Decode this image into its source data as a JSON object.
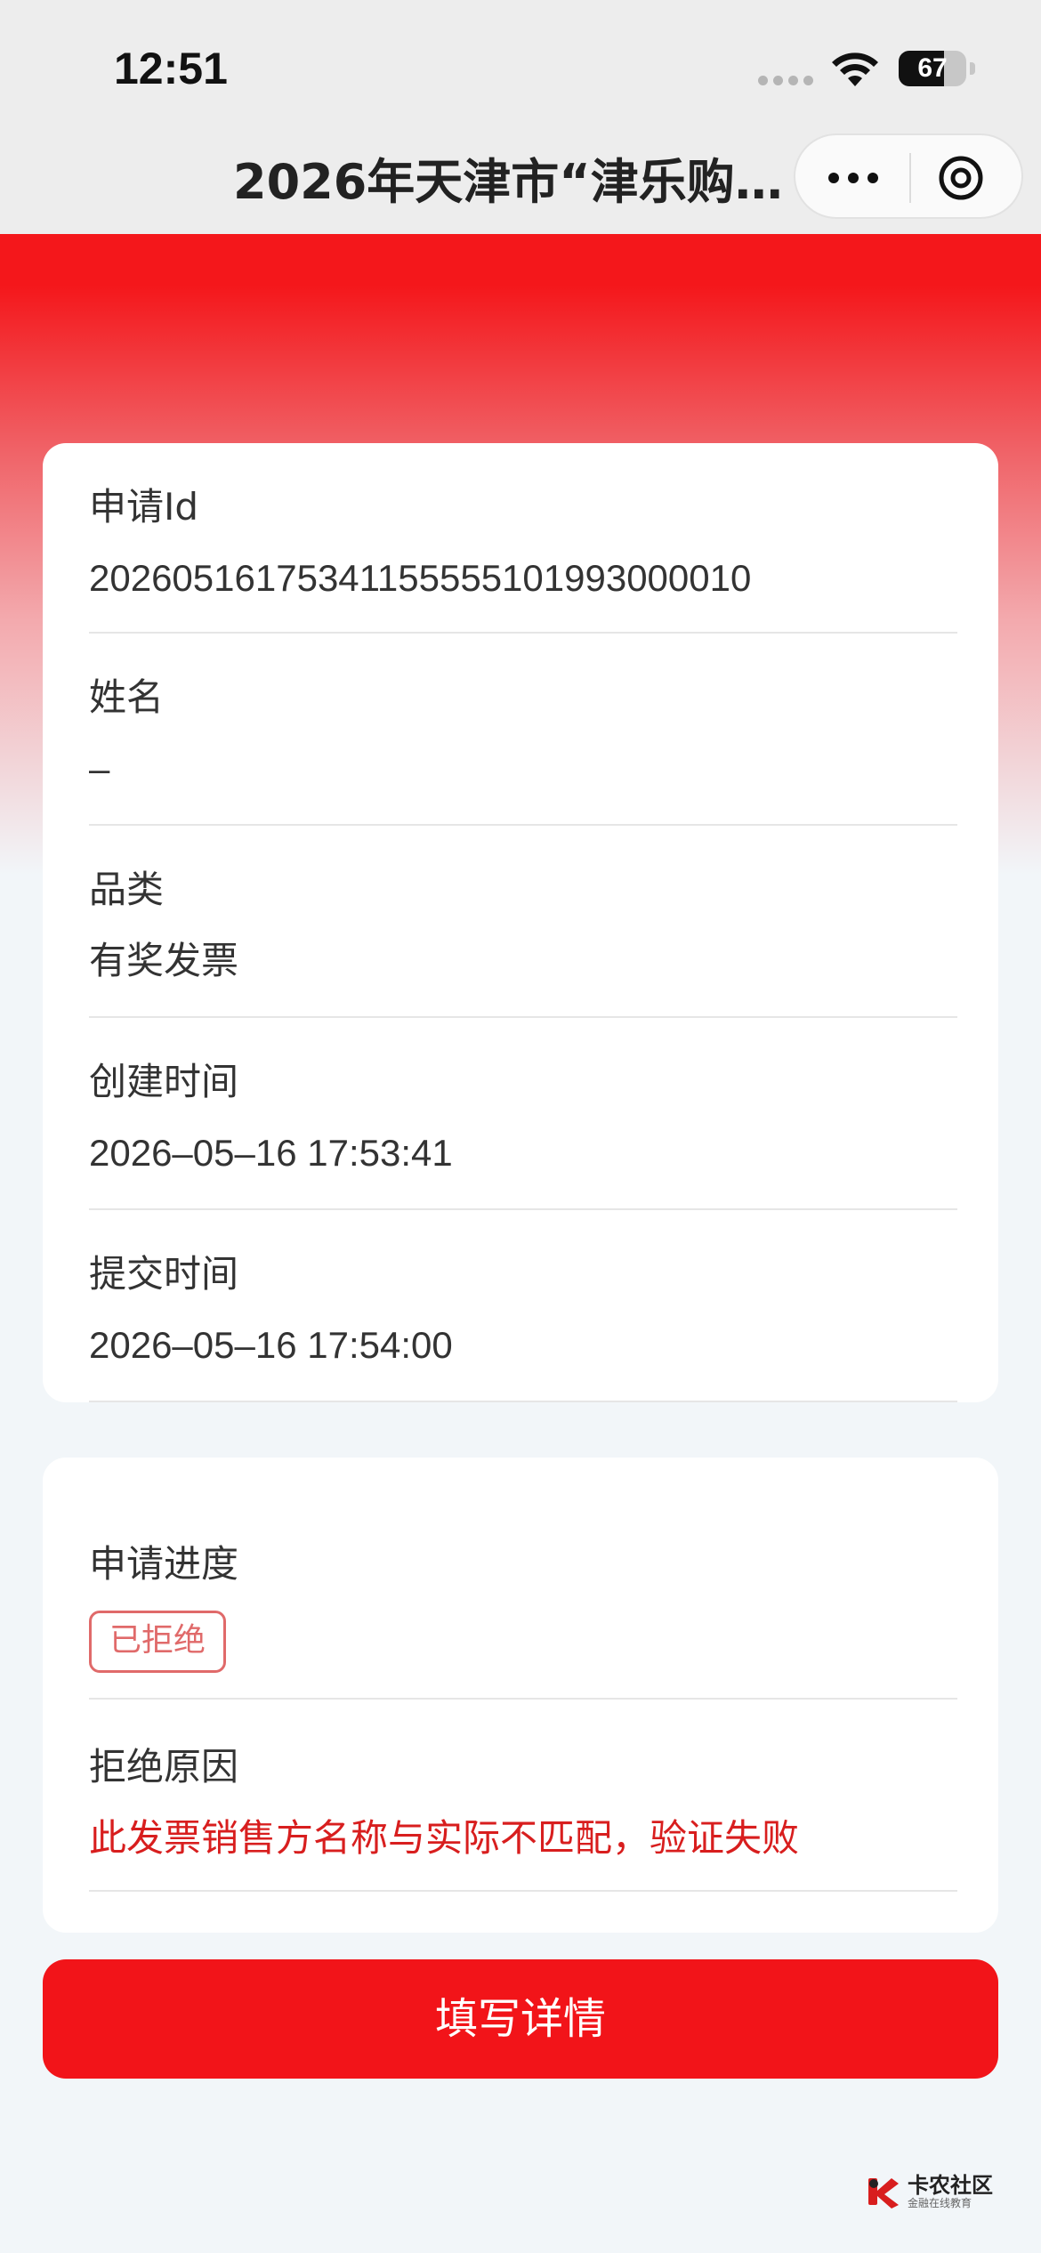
{
  "status_bar": {
    "time": "12:51",
    "battery": "67",
    "battery_level": 0.67
  },
  "nav": {
    "title": "2026年天津市“津乐购”...",
    "more_icon": "more-dots-icon",
    "close_icon": "close-circle-icon"
  },
  "application": {
    "fields": [
      {
        "label": "申请Id",
        "value": "20260516175341155555101993000010"
      },
      {
        "label": "姓名",
        "value": "–"
      },
      {
        "label": "品类",
        "value": "有奖发票"
      },
      {
        "label": "创建时间",
        "value": "2026–05–16 17:53:41"
      },
      {
        "label": "提交时间",
        "value": "2026–05–16 17:54:00"
      }
    ]
  },
  "progress": {
    "label": "申请进度",
    "status": "已拒绝",
    "status_color": "#e06a6a",
    "reason_label": "拒绝原因",
    "reason": "此发票销售方名称与实际不匹配，验证失败",
    "reason_color": "#d81e1e"
  },
  "action": {
    "button_label": "填写详情",
    "color": "#f21419"
  },
  "watermark": {
    "title": "卡农社区",
    "subtitle": "金融在线教育"
  }
}
